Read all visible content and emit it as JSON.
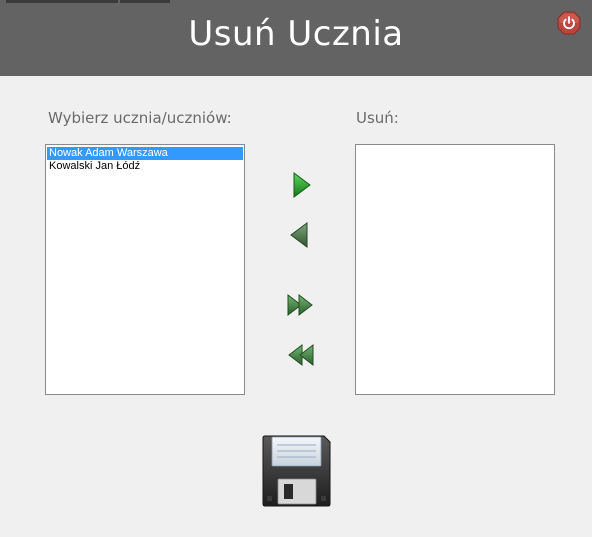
{
  "window": {
    "title": "Usuń Ucznia"
  },
  "left_panel": {
    "label": "Wybierz ucznia/uczniów:",
    "items": [
      {
        "label": "Nowak Adam Warszawa",
        "selected": true
      },
      {
        "label": "Kowalski Jan Łódź",
        "selected": false
      }
    ]
  },
  "right_panel": {
    "label": "Usuń:",
    "items": []
  },
  "colors": {
    "title_bar": "#636363",
    "selection": "#3399ff",
    "arrow_green": "#22a022",
    "arrow_dark_green": "#3d6b3d",
    "power_button": "#c0453c"
  },
  "icons": {
    "move_right": "arrow-right-icon",
    "move_left": "arrow-left-icon",
    "move_all_right": "double-arrow-right-icon",
    "move_all_left": "double-arrow-left-icon",
    "save": "floppy-disk-icon",
    "power": "power-icon"
  }
}
